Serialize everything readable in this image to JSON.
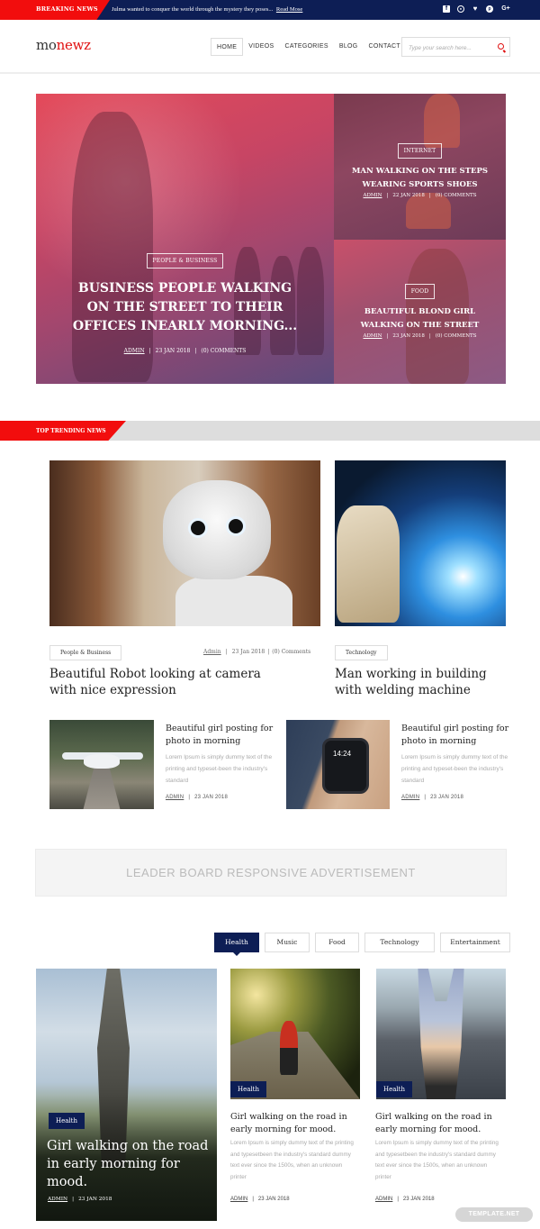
{
  "topbar": {
    "breaking_label": "BREAKING NEWS",
    "breaking_text": "Julma wanted to conquer the world through the mystery they poses...",
    "read_more": "Read Mose",
    "social": [
      {
        "name": "facebook-icon",
        "glyph": "f"
      },
      {
        "name": "instagram-icon",
        "glyph": "◎"
      },
      {
        "name": "twitter-icon",
        "glyph": "🐦"
      },
      {
        "name": "pinterest-icon",
        "glyph": "p"
      },
      {
        "name": "google-plus-icon",
        "glyph": "G+"
      }
    ]
  },
  "header": {
    "logo_part1": "mo",
    "logo_part2": "newz",
    "nav": [
      "HOME",
      "VIDEOS",
      "CATEGORIES",
      "BLOG",
      "CONTACT"
    ],
    "active_nav": "HOME",
    "search_placeholder": "Type your search here...",
    "search_value": ""
  },
  "hero": {
    "main": {
      "category": "PEOPLE & BUSINESS",
      "title": "BUSINESS PEOPLE WALKING ON THE STREET TO THEIR OFFICES INEARLY MORNING...",
      "author": "ADMIN",
      "date": "23 JAN 2018",
      "comments": "(0) COMMENTS"
    },
    "side1": {
      "category": "INTERNET",
      "title": "MAN WALKING ON THE STEPS WEARING SPORTS SHOES",
      "author": "ADMIN",
      "date": "22 JAN 2018",
      "comments": "(0) COMMENTS"
    },
    "side2": {
      "category": "FOOD",
      "title": "BEAUTIFUL BLOND GIRL WALKING ON THE STREET",
      "author": "ADMIN",
      "date": "23 JAN 2018",
      "comments": "(0) COMMENTS"
    }
  },
  "trending": {
    "section_label": "TOP TRENDING NEWS",
    "feature1": {
      "category": "People & Business",
      "author": "Admin",
      "date": "23 Jan 2018",
      "comments": "(0) Comments",
      "title": "Beautiful Robot looking at camera with nice expression"
    },
    "feature2": {
      "category": "Technology",
      "title": "Man working in building with welding machine"
    },
    "small": [
      {
        "title": "Beautiful girl posting for photo in morning",
        "desc": "Lorem Ipsum is simply dummy text of the printing and typeset-been the industry's standard",
        "author": "ADMIN",
        "date": "23 JAN 2018"
      },
      {
        "title": "Beautiful girl posting for photo in morning",
        "desc": "Lorem Ipsum is simply dummy text of the printing and typeset-been the industry's standard",
        "author": "ADMIN",
        "date": "23 JAN 2018"
      }
    ]
  },
  "ad": {
    "text": "LEADER BOARD RESPONSIVE ADVERTISEMENT"
  },
  "category_tabs": {
    "tabs": [
      "Health",
      "Music",
      "Food",
      "Technology",
      "Entertainment"
    ],
    "active": "Health"
  },
  "category_posts": {
    "featured": {
      "tag": "Health",
      "title": "Girl walking on the road in early morning for mood.",
      "author": "ADMIN",
      "date": "23 JAN 2018"
    },
    "cards": [
      {
        "tag": "Health",
        "title": "Girl walking on the road in early morning for mood.",
        "desc": "Lorem Ipsum is simply dummy text of the printing and typesetbeen the industry's standard dummy text ever since the 1500s, when an unknown printer",
        "author": "ADMIN",
        "date": "23 JAN 2018"
      },
      {
        "tag": "Health",
        "title": "Girl walking on the road in early morning for mood.",
        "desc": "Lorem Ipsum is simply dummy text of the printing and typesetbeen the industry's standard dummy text ever since the 1500s, when an unknown printer",
        "author": "ADMIN",
        "date": "23 JAN 2018"
      }
    ]
  },
  "watermark": "TEMPLATE.NET",
  "colors": {
    "brand_red": "#f20d0d",
    "navy": "#0d1e55",
    "band_gray": "#dddddd"
  }
}
